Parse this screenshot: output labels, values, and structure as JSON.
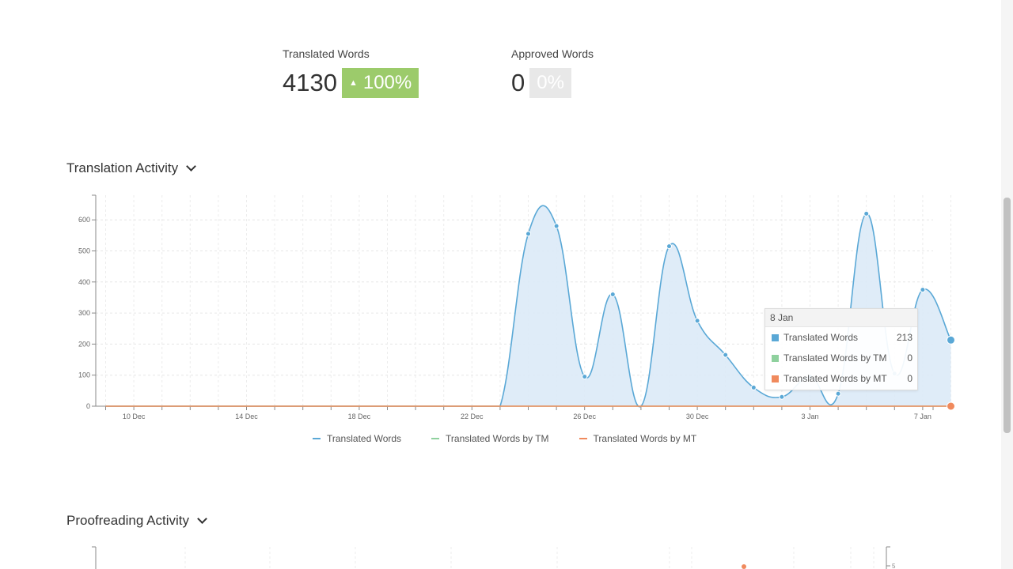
{
  "stats": {
    "translated": {
      "label": "Translated Words",
      "value": "4130",
      "badge": "100%",
      "badge_arrow": "▲"
    },
    "approved": {
      "label": "Approved Words",
      "value": "0",
      "badge": "0%"
    }
  },
  "sections": {
    "translation": "Translation Activity",
    "proofreading": "Proofreading Activity"
  },
  "colors": {
    "translated": "#5aa8d6",
    "tm": "#8fd19e",
    "mt": "#f08a5d",
    "area": "#dbeaf7",
    "badge_up": "#9ccb6b"
  },
  "chart_data": {
    "type": "area",
    "x": [
      "9 Dec",
      "10 Dec",
      "11 Dec",
      "12 Dec",
      "13 Dec",
      "14 Dec",
      "15 Dec",
      "16 Dec",
      "17 Dec",
      "18 Dec",
      "19 Dec",
      "20 Dec",
      "21 Dec",
      "22 Dec",
      "23 Dec",
      "24 Dec",
      "25 Dec",
      "26 Dec",
      "27 Dec",
      "28 Dec",
      "29 Dec",
      "30 Dec",
      "31 Dec",
      "1 Jan",
      "2 Jan",
      "3 Jan",
      "4 Jan",
      "5 Jan",
      "6 Jan",
      "7 Jan",
      "8 Jan"
    ],
    "x_tick_labels": [
      "10 Dec",
      "14 Dec",
      "18 Dec",
      "22 Dec",
      "26 Dec",
      "30 Dec",
      "3 Jan",
      "7 Jan"
    ],
    "y_ticks": [
      0,
      100,
      200,
      300,
      400,
      500,
      600
    ],
    "ylim": [
      0,
      680
    ],
    "series": [
      {
        "name": "Translated Words",
        "values": [
          0,
          0,
          0,
          0,
          0,
          0,
          0,
          0,
          0,
          0,
          0,
          0,
          0,
          0,
          0,
          555,
          580,
          95,
          360,
          0,
          515,
          275,
          165,
          60,
          30,
          95,
          40,
          620,
          105,
          375,
          213
        ]
      },
      {
        "name": "Translated Words by TM",
        "values": [
          0,
          0,
          0,
          0,
          0,
          0,
          0,
          0,
          0,
          0,
          0,
          0,
          0,
          0,
          0,
          0,
          0,
          0,
          0,
          0,
          0,
          0,
          0,
          0,
          0,
          0,
          0,
          0,
          0,
          0,
          0
        ]
      },
      {
        "name": "Translated Words by MT",
        "values": [
          0,
          0,
          0,
          0,
          0,
          0,
          0,
          0,
          0,
          0,
          0,
          0,
          0,
          0,
          0,
          0,
          0,
          0,
          0,
          0,
          0,
          0,
          0,
          0,
          0,
          0,
          0,
          0,
          0,
          0,
          0
        ]
      }
    ],
    "legend_position": "bottom",
    "grid": true
  },
  "tooltip": {
    "date": "8 Jan",
    "rows": [
      {
        "name": "Translated Words",
        "value": "213"
      },
      {
        "name": "Translated Words by TM",
        "value": "0"
      },
      {
        "name": "Translated Words by MT",
        "value": "0"
      }
    ]
  },
  "proofreading_chart": {
    "y_tick": "5"
  }
}
